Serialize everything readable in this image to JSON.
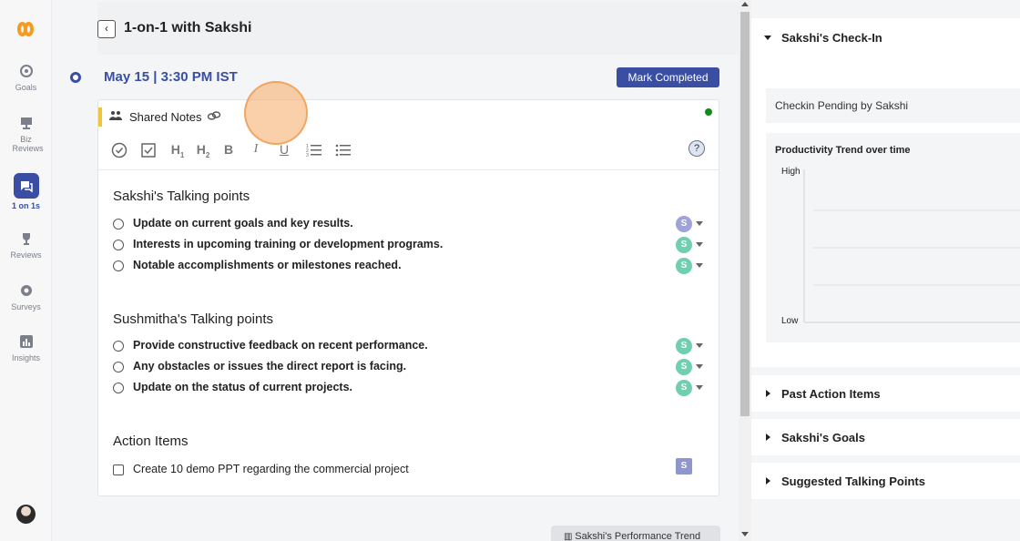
{
  "app": {
    "brand_color": "#3a4ea3",
    "accent_color": "#f2c33c"
  },
  "nav": {
    "logo": "logo-icon",
    "items": [
      {
        "label": "Goals",
        "icon": "target-icon"
      },
      {
        "label": "Biz Reviews",
        "icon": "presentation-icon"
      },
      {
        "label": "1 on 1s",
        "icon": "chat-icon",
        "active": true
      },
      {
        "label": "Reviews",
        "icon": "trophy-icon"
      },
      {
        "label": "Surveys",
        "icon": "survey-icon"
      },
      {
        "label": "Insights",
        "icon": "bar-chart-icon"
      }
    ]
  },
  "header": {
    "title": "1-on-1 with Sakshi",
    "date": "May 15 | 3:30 PM IST",
    "mark_completed": "Mark Completed"
  },
  "notes": {
    "label": "Shared Notes",
    "toolbar": [
      "check-circle-icon",
      "checkbox-icon",
      "H1",
      "H2",
      "B",
      "I",
      "U",
      "ordered-list-icon",
      "bullet-list-icon"
    ],
    "help": "?",
    "sections": [
      {
        "title": "Sakshi's Talking points",
        "items": [
          {
            "text": "Update on current goals and key results.",
            "assignee": "S",
            "color": "#9ea3d9"
          },
          {
            "text": "Interests in upcoming training or development programs.",
            "assignee": "S",
            "color": "#6fcfb0"
          },
          {
            "text": "Notable accomplishments or milestones reached.",
            "assignee": "S",
            "color": "#6fcfb0"
          }
        ]
      },
      {
        "title": "Sushmitha's Talking points",
        "items": [
          {
            "text": " Provide constructive feedback on recent performance.",
            "assignee": "S",
            "color": "#6fcfb0"
          },
          {
            "text": "Any obstacles or issues the direct report is facing.",
            "assignee": "S",
            "color": "#6fcfb0"
          },
          {
            "text": "Update on the status of current projects.",
            "assignee": "S",
            "color": "#6fcfb0"
          }
        ]
      },
      {
        "title": "Action Items",
        "items": [
          {
            "text": "Create 10 demo PPT regarding the commercial project",
            "assignee": "S",
            "color": "#8f95cf"
          }
        ]
      }
    ]
  },
  "footer_tab": {
    "label": "Sakshi's Performance Trend"
  },
  "right_panel": {
    "checkin_title": "Sakshi's Check-In",
    "checkin_status": "Checkin Pending by Sakshi",
    "trend_title": "Productivity Trend over time",
    "trend_high": "High",
    "trend_low": "Low",
    "past_action_items": "Past Action Items",
    "goals": "Sakshi's Goals",
    "suggested": "Suggested Talking Points"
  }
}
